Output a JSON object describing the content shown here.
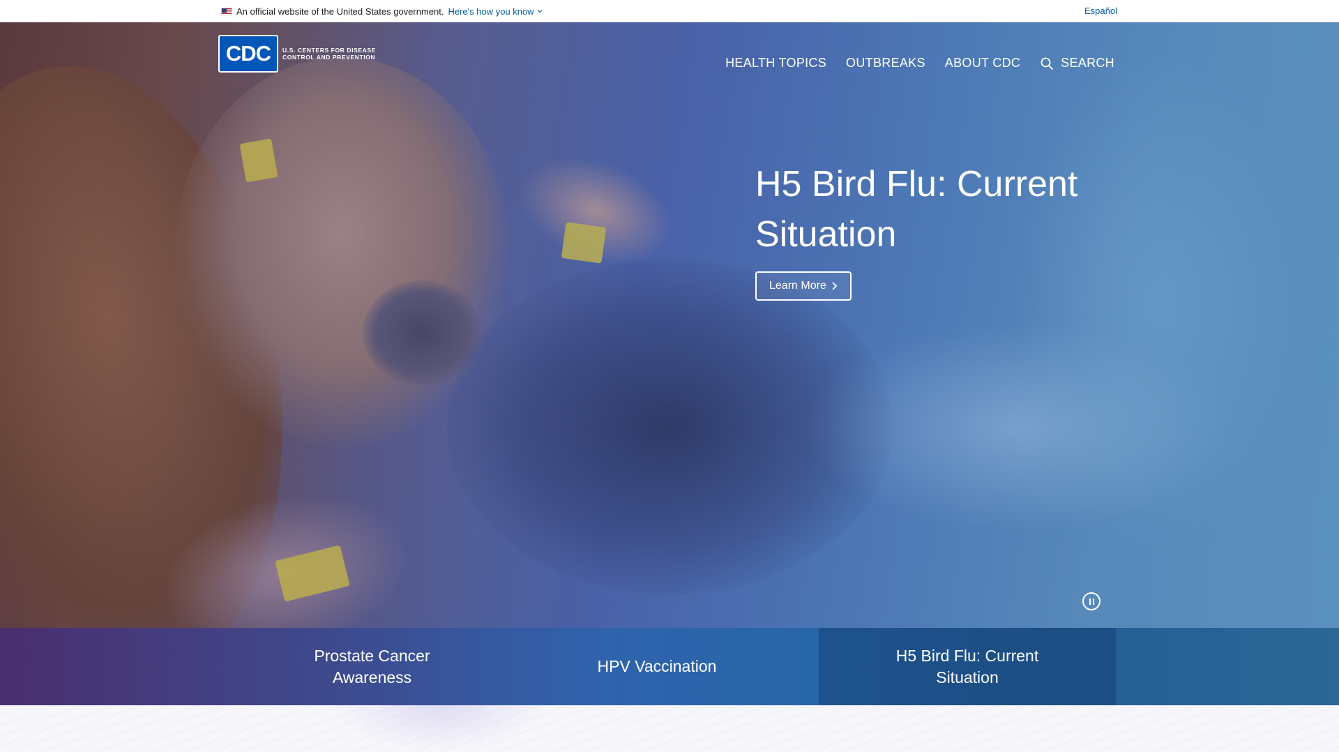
{
  "gov_banner": {
    "text": "An official website of the United States government.",
    "link": "Here's how you know",
    "language_link": "Español"
  },
  "logo": {
    "wordmark": "CDC",
    "line1": "U.S. CENTERS FOR DISEASE",
    "line2": "CONTROL AND PREVENTION"
  },
  "nav": {
    "items": [
      "HEALTH TOPICS",
      "OUTBREAKS",
      "ABOUT CDC"
    ],
    "search_label": "SEARCH"
  },
  "hero": {
    "title_line1": "H5 Bird Flu: Current",
    "title_line2": "Situation",
    "button_label": "Learn More",
    "pause_control": "pause-icon"
  },
  "carousel_tabs": [
    {
      "label": "Prostate Cancer Awareness"
    },
    {
      "label": "HPV Vaccination"
    },
    {
      "label": "H5 Bird Flu: Current Situation",
      "active": true
    }
  ],
  "colors": {
    "link_blue": "#005ea2",
    "logo_blue": "#0057b7",
    "tab_purple": "#4a2f6e",
    "tab_blue": "#2766a8"
  }
}
